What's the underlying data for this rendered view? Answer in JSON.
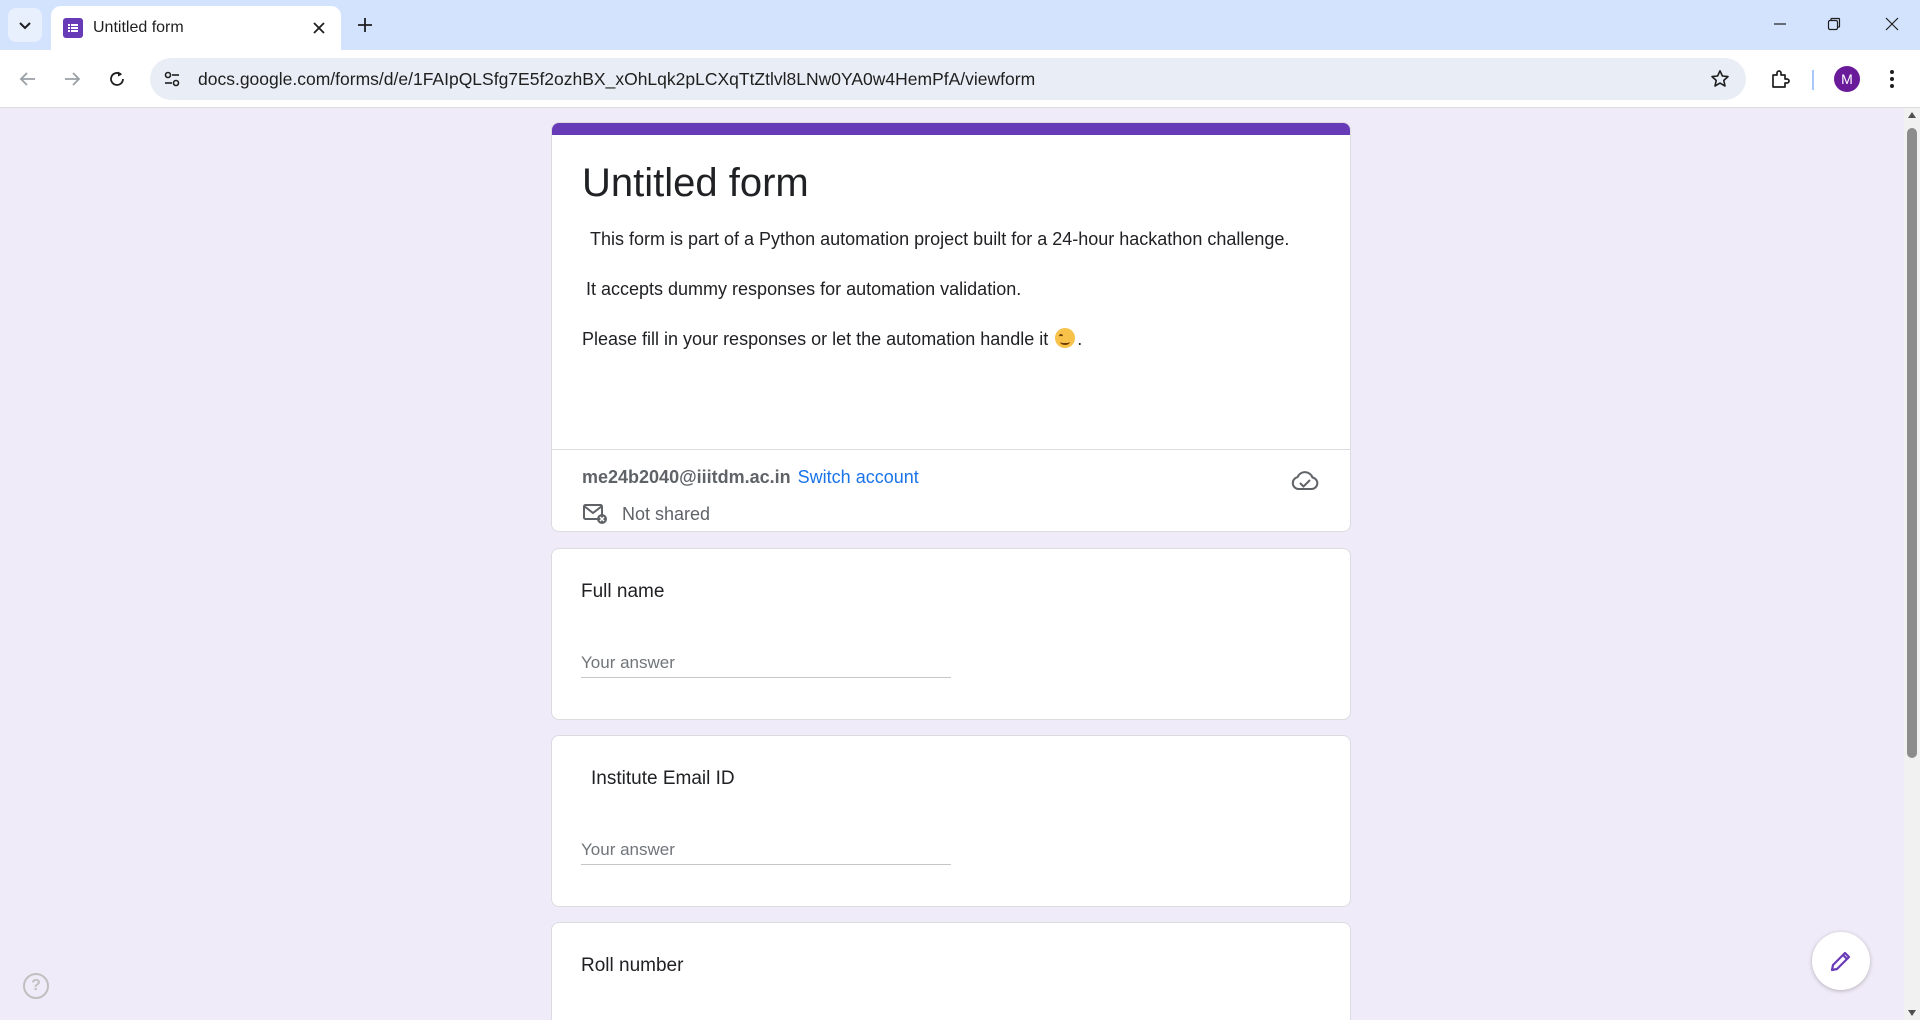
{
  "browser": {
    "tab_title": "Untitled form",
    "url": "docs.google.com/forms/d/e/1FAIpQLSfg7E5f2ozhBX_xOhLqk2pLCXqTtZtlvl8LNw0YA0w4HemPfA/viewform",
    "profile_initial": "M",
    "icons": [
      "tab-list-icon",
      "forms-favicon",
      "close-icon",
      "plus-icon",
      "minimize-icon",
      "restore-icon",
      "window-close-icon",
      "back-arrow-icon",
      "forward-arrow-icon",
      "reload-icon",
      "site-info-icon",
      "star-icon",
      "extensions-icon",
      "more-menu-icon"
    ]
  },
  "form": {
    "title": "Untitled form",
    "description": [
      "This form is part of a Python automation project built for a 24-hour hackathon challenge.",
      "It accepts dummy responses for automation validation.",
      "Please fill in your responses or let the automation handle it",
      "."
    ],
    "account_email": "me24b2040@iiitdm.ac.in",
    "switch_account_label": "Switch account",
    "shared_status": "Not shared",
    "accent_color": "#673ab7",
    "background_color": "#f0ebf8"
  },
  "questions": [
    {
      "title": "Full name",
      "placeholder": "Your answer"
    },
    {
      "title": "Institute Email ID",
      "placeholder": "Your answer"
    },
    {
      "title": "Roll number"
    }
  ],
  "floating": {
    "help_label": "?",
    "icons": [
      "help-icon",
      "pencil-icon",
      "cloud-icon",
      "mail-not-shared-icon"
    ]
  }
}
